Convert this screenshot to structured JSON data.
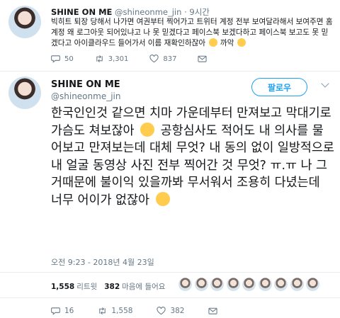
{
  "tweet1": {
    "name": "SHINE ON ME",
    "handle": "@shineonme_jin",
    "time": "· 9시간",
    "text": "빅히트 퇴장 당해서 나가면 여권부터 찍어가고 트위터 계정 전부 보여달라해서 보여주면 홈계정 왜 로그아웃 되어있냐고 나 못 믿겠다고 페이스북 보겠다하고 페이스북 보고도 못 믿겠다고 아이클라우드 들어가서 이름 재확인하잖아",
    "text_end": "까악",
    "replies": "50",
    "retweets": "3,301",
    "likes": "837"
  },
  "tweet2": {
    "name": "SHINE ON ME",
    "handle": "@shineonme_jin",
    "follow_label": "팔로우",
    "text_1": "한국인인것 같으면 치마 가운데부터 만져보고 막대기로 가슴도 쳐보잖아",
    "text_2": "공항심사도 적어도 내 의사를 물어보고 만져보는데 대체 무엇? 내 동의 없이 일방적으로 내 얼굴 동영상 사진 전부 찍어간 것 무엇? ㅠ.ㅠ 나 그거때문에 불이익 있을까봐 무서워서 조용히 다녔는데 너무 어이가 없잖아",
    "date": "오전 9:23 - 2018년 4월 23일",
    "retweet_count": "1,558",
    "retweet_word": "리트윗",
    "like_count": "382",
    "like_word": "마음에 들어요",
    "replies": "16",
    "retweets": "1,558",
    "likes": "382"
  },
  "icons": {
    "reply": "reply-icon",
    "retweet": "retweet-icon",
    "like": "heart-icon",
    "dm": "envelope-icon",
    "more": "chevron-down-icon"
  },
  "colors": {
    "accent": "#1da1f2",
    "muted": "#657786",
    "emoji": "#ffcc4d"
  }
}
